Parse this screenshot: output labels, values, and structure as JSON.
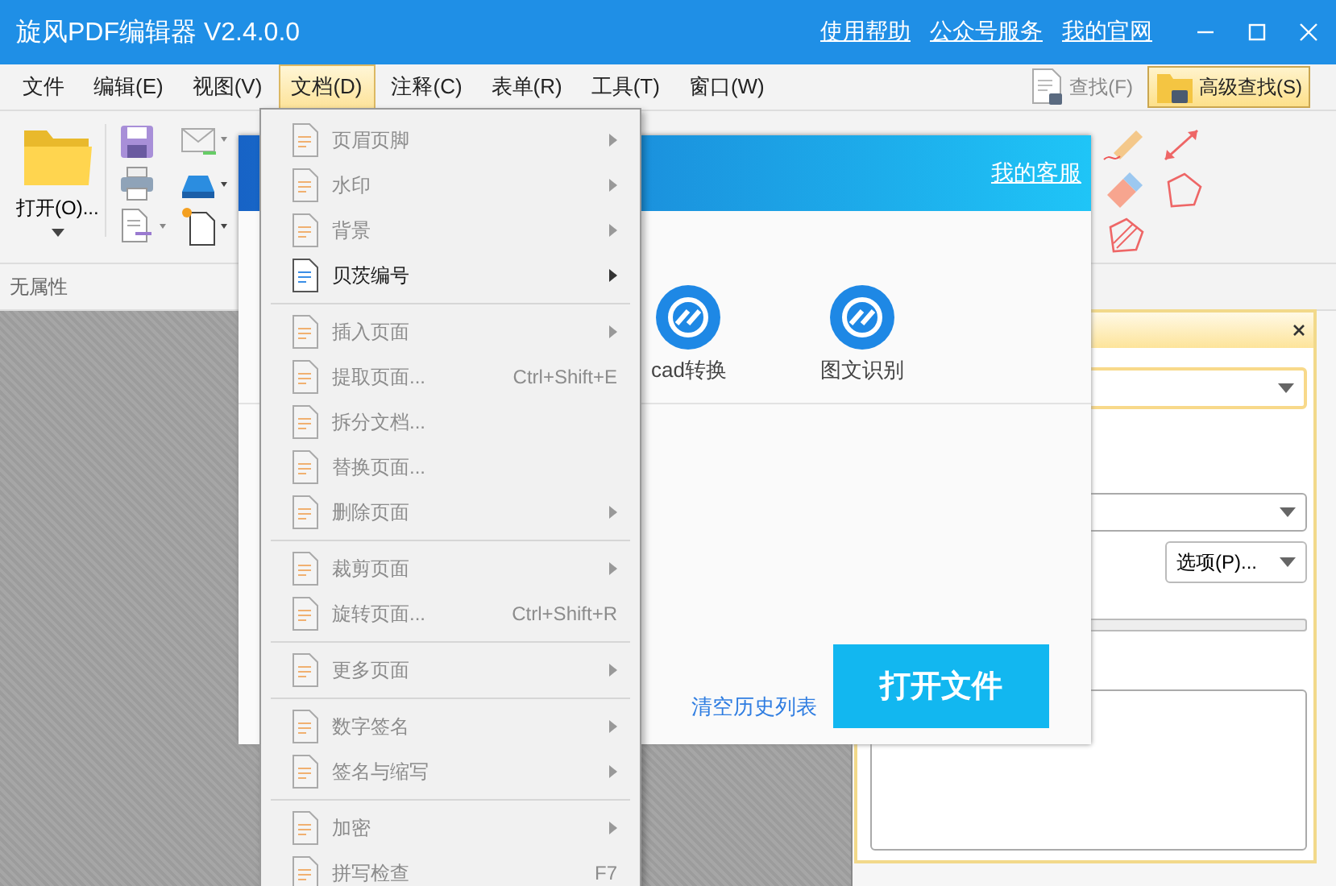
{
  "window": {
    "title": "旋风PDF编辑器 V2.4.0.0",
    "links": [
      "使用帮助",
      "公众号服务",
      "我的官网"
    ]
  },
  "menubar": {
    "items": [
      {
        "label": "文件",
        "selected": false
      },
      {
        "label": "编辑(E)",
        "selected": false
      },
      {
        "label": "视图(V)",
        "selected": false
      },
      {
        "label": "文档(D)",
        "selected": true
      },
      {
        "label": "注释(C)",
        "selected": false
      },
      {
        "label": "表单(R)",
        "selected": false
      },
      {
        "label": "工具(T)",
        "selected": false
      },
      {
        "label": "窗口(W)",
        "selected": false
      }
    ],
    "find": "查找(F)",
    "advanced_find": "高级查找(S)"
  },
  "ribbon": {
    "open_button": "打开(O)..."
  },
  "properties_bar": {
    "text": "无属性"
  },
  "start_dialog": {
    "support_link": "我的客服",
    "tools": [
      {
        "label": "cad转换"
      },
      {
        "label": "图文识别"
      }
    ],
    "clear_history": "清空历史列表",
    "open_button": "打开文件"
  },
  "document_menu": {
    "groups": [
      {
        "items": [
          {
            "label": "页眉页脚",
            "disabled": true,
            "submenu": true
          },
          {
            "label": "水印",
            "disabled": true,
            "submenu": true
          },
          {
            "label": "背景",
            "disabled": true,
            "submenu": true
          },
          {
            "label": "贝茨编号",
            "disabled": false,
            "submenu": true
          }
        ]
      },
      {
        "items": [
          {
            "label": "插入页面",
            "disabled": true,
            "submenu": true
          },
          {
            "label": "提取页面...",
            "disabled": true,
            "submenu": false,
            "shortcut": "Ctrl+Shift+E"
          },
          {
            "label": "拆分文档...",
            "disabled": true,
            "submenu": false
          },
          {
            "label": "替换页面...",
            "disabled": true,
            "submenu": false
          },
          {
            "label": "删除页面",
            "disabled": true,
            "submenu": true
          }
        ]
      },
      {
        "items": [
          {
            "label": "裁剪页面",
            "disabled": true,
            "submenu": true
          },
          {
            "label": "旋转页面...",
            "disabled": true,
            "submenu": false,
            "shortcut": "Ctrl+Shift+R"
          }
        ]
      },
      {
        "items": [
          {
            "label": "更多页面",
            "disabled": true,
            "submenu": true
          }
        ]
      },
      {
        "items": [
          {
            "label": "数字签名",
            "disabled": true,
            "submenu": true
          },
          {
            "label": "签名与缩写",
            "disabled": true,
            "submenu": true
          }
        ]
      },
      {
        "items": [
          {
            "label": "加密",
            "disabled": true,
            "submenu": true
          },
          {
            "label": "拼写检查",
            "disabled": true,
            "submenu": false,
            "shortcut": "F7"
          }
        ]
      }
    ]
  },
  "side_panel": {
    "options_button": "选项(P)..."
  }
}
